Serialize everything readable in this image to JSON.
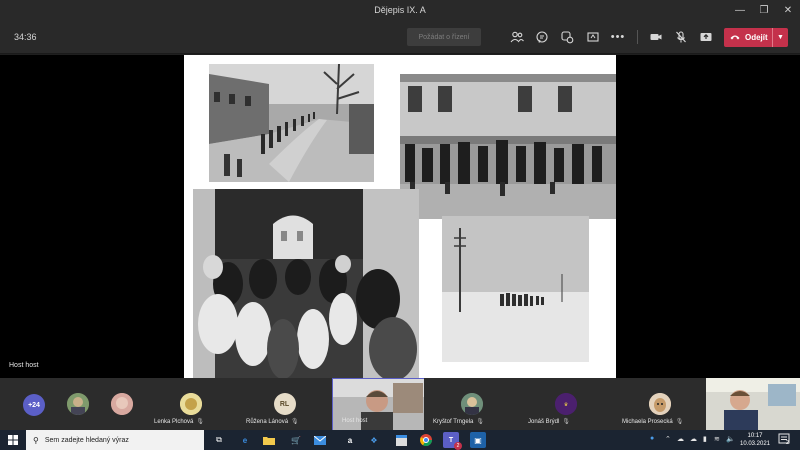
{
  "window": {
    "title": "Dějepis IX. A"
  },
  "toolbar": {
    "timer": "34:36",
    "raise_hand_label": "Požádat o řízení",
    "leave_label": "Odejít"
  },
  "stage": {
    "presenter_label": "Host host"
  },
  "participants": {
    "overflow_count": "+24",
    "tiles": [
      {
        "name": "Lenka Plchová",
        "initials": ""
      },
      {
        "name": "Růžena Lánová",
        "initials": "RL"
      },
      {
        "name": "Host host",
        "initials": ""
      },
      {
        "name": "Kryštof Trngela",
        "initials": ""
      },
      {
        "name": "Jonáš Brýdl",
        "initials": ""
      },
      {
        "name": "Michaela Prosecká",
        "initials": ""
      }
    ]
  },
  "taskbar": {
    "search_placeholder": "Sem zadejte hledaný výraz",
    "teams_badge": "2",
    "time": "10:17",
    "date": "10.03.2021",
    "notification_count": "2"
  },
  "colors": {
    "leave_red": "#c4314b",
    "teams_purple": "#5b5fc7",
    "taskbar": "#1b2431"
  }
}
